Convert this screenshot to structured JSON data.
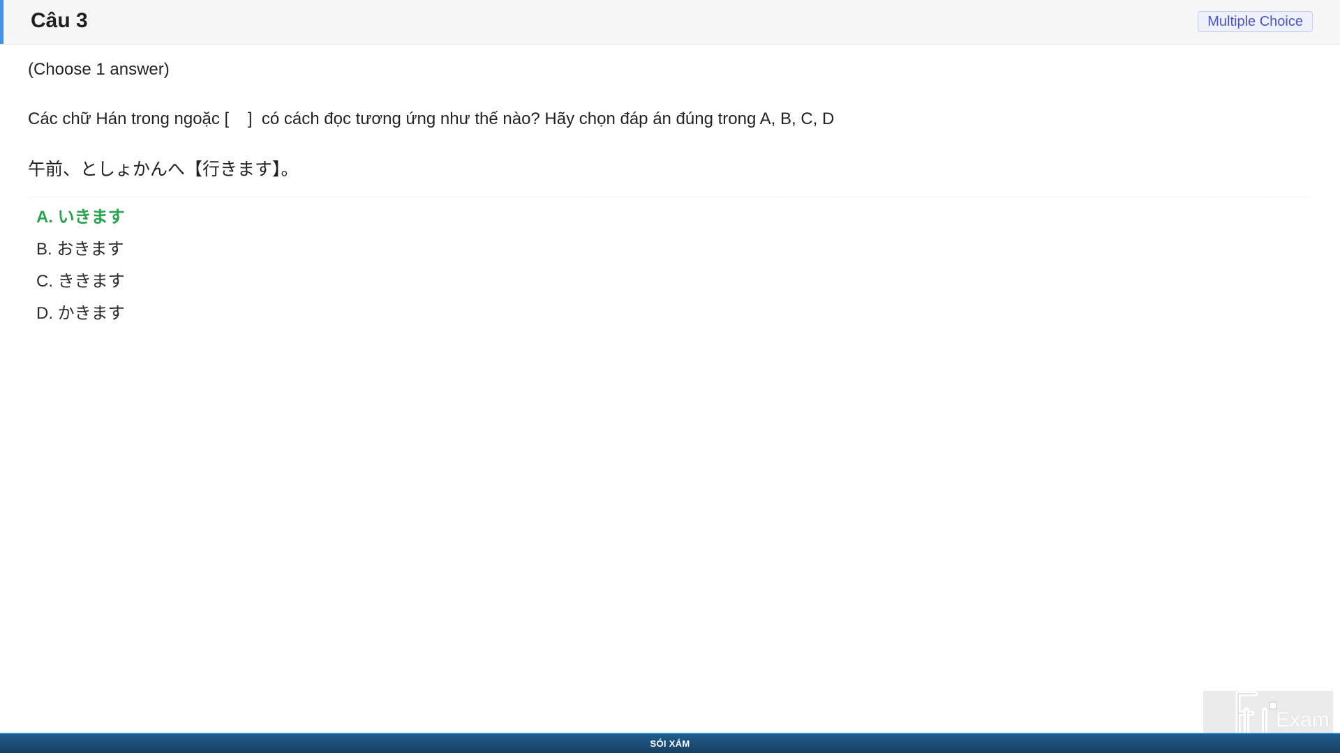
{
  "header": {
    "title": "Câu 3",
    "type_badge": "Multiple Choice",
    "accent_color": "#4a90e2"
  },
  "question": {
    "instruction": "(Choose 1 answer)",
    "prompt": "Các chữ Hán trong ngoặc [    ]  có cách đọc tương ứng như thế nào? Hãy chọn đáp án đúng trong A, B, C, D",
    "sentence": "午前、としょかんへ【行きます】。",
    "options": [
      {
        "label": "A. いきます",
        "correct": true
      },
      {
        "label": "B. おきます",
        "correct": false
      },
      {
        "label": "C. ききます",
        "correct": false
      },
      {
        "label": "D. かきます",
        "correct": false
      }
    ],
    "correct_color": "#2aa24f"
  },
  "footer": {
    "text": "SÓI XÁM"
  },
  "watermark": {
    "logo_icon": "fu-exam-logo-icon",
    "text": "Exam"
  }
}
